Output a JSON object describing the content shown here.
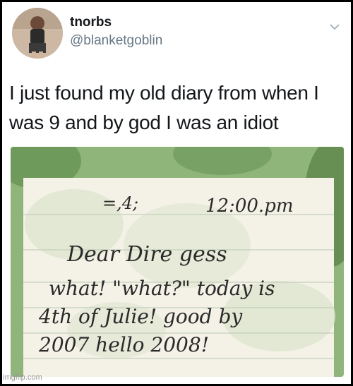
{
  "tweet": {
    "display_name": "tnorbs",
    "handle": "@blanketgoblin",
    "text_line_1": "I just found my old diary from when I",
    "text_line_2": "was 9 and by god I was an idiot"
  },
  "diary": {
    "date": "=,4;",
    "time": "12:00.pm",
    "line_1": "Dear Dire gess",
    "line_2": "what! \"what?\" today is",
    "line_3": "4th of Julie! good by",
    "line_4": "2007 hello 2008!"
  },
  "watermark": "imgflip.com",
  "icons": {
    "menu": "chevron-down-icon"
  },
  "colors": {
    "frame": "#000000",
    "name": "#14171a",
    "handle": "#657786",
    "paper_green": "#a9c98a",
    "ink": "#2a2a2a"
  }
}
